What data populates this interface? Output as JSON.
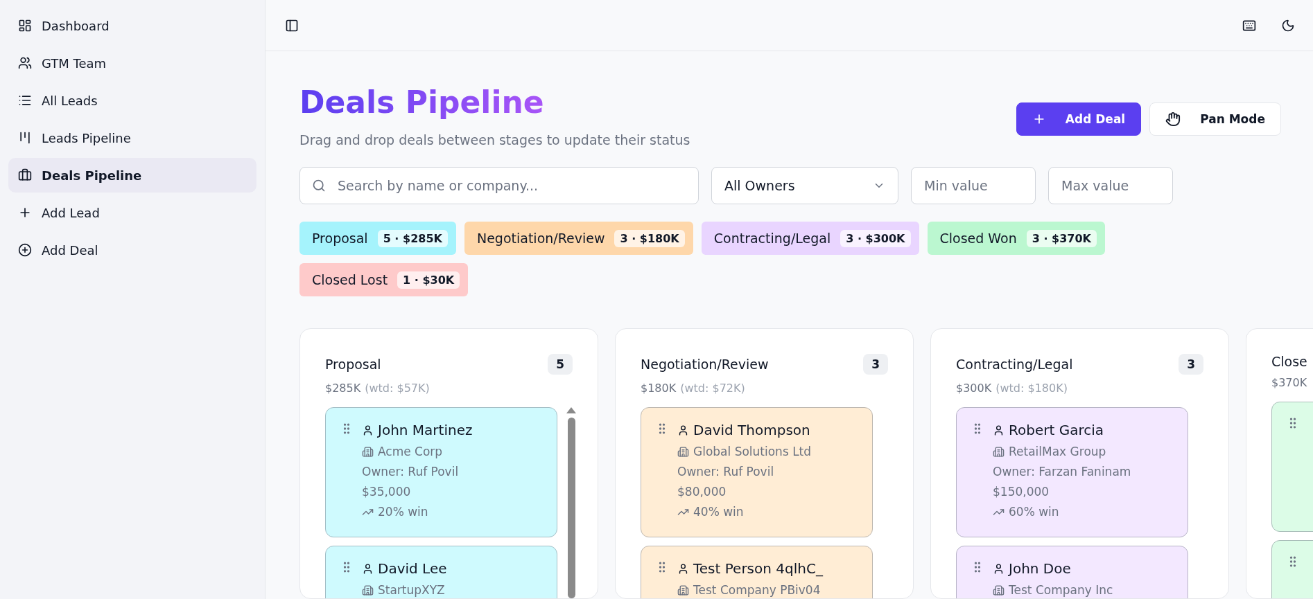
{
  "sidebar": {
    "items": [
      {
        "label": "Dashboard",
        "selected": false
      },
      {
        "label": "GTM Team",
        "selected": false
      },
      {
        "label": "All Leads",
        "selected": false
      },
      {
        "label": "Leads Pipeline",
        "selected": false
      },
      {
        "label": "Deals Pipeline",
        "selected": true
      },
      {
        "label": "Add Lead",
        "selected": false
      },
      {
        "label": "Add Deal",
        "selected": false
      }
    ]
  },
  "header": {
    "title": "Deals Pipeline",
    "subtitle": "Drag and drop deals between stages to update their status",
    "buttons": [
      {
        "kind": "primary",
        "label": "Add Deal"
      },
      {
        "kind": "secondary",
        "label": "Pan Mode"
      }
    ]
  },
  "filters": {
    "search": {
      "placeholder": "Search by name or company..."
    },
    "owner": {
      "value": "All Owners"
    },
    "min": {
      "placeholder": "Min value"
    },
    "max": {
      "placeholder": "Max value"
    }
  },
  "stages": [
    {
      "label": "Proposal",
      "summary": "5 · $285K",
      "color": "#a5f3fc"
    },
    {
      "label": "Negotiation/Review",
      "summary": "3 · $180K",
      "color": "#fed7aa"
    },
    {
      "label": "Contracting/Legal",
      "summary": "3 · $300K",
      "color": "#e9d5ff"
    },
    {
      "label": "Closed Won",
      "summary": "3 · $370K",
      "color": "#bbf7d0"
    },
    {
      "label": "Closed Lost",
      "summary": "1 · $30K",
      "color": "#fecaca"
    }
  ],
  "columns": [
    {
      "title": "Proposal",
      "count": "5",
      "total": "$285K",
      "weighted": "(wtd: $57K)",
      "color": "#cffafe",
      "scrollable": true,
      "deals": [
        {
          "kind": "card",
          "name": "John Martinez",
          "company": "Acme Corp",
          "owner": "Owner: Ruf Povil",
          "value": "$35,000",
          "win": "20% win"
        },
        {
          "kind": "card",
          "name": "David Lee",
          "company": "StartupXYZ"
        }
      ]
    },
    {
      "title": "Negotiation/Review",
      "count": "3",
      "total": "$180K",
      "weighted": "(wtd: $72K)",
      "color": "#ffedd5",
      "scrollable": false,
      "deals": [
        {
          "kind": "card",
          "name": "David Thompson",
          "company": "Global Solutions Ltd",
          "owner": "Owner: Ruf Povil",
          "value": "$80,000",
          "win": "40% win"
        },
        {
          "kind": "card",
          "name": "Test Person 4qlhC_",
          "company": "Test Company PBiv04"
        }
      ]
    },
    {
      "title": "Contracting/Legal",
      "count": "3",
      "total": "$300K",
      "weighted": "(wtd: $180K)",
      "color": "#f3e8ff",
      "scrollable": false,
      "deals": [
        {
          "kind": "card",
          "name": "Robert Garcia",
          "company": "RetailMax Group",
          "owner": "Owner: Farzan Faninam",
          "value": "$150,000",
          "win": "60% win"
        },
        {
          "kind": "card",
          "name": "John Doe",
          "company": "Test Company Inc"
        }
      ]
    },
    {
      "title": "Close",
      "total": "$370K",
      "color": "#dcfce7",
      "scrollable": false,
      "deals": [
        {
          "kind": "cut"
        },
        {
          "kind": "cut"
        }
      ]
    }
  ]
}
